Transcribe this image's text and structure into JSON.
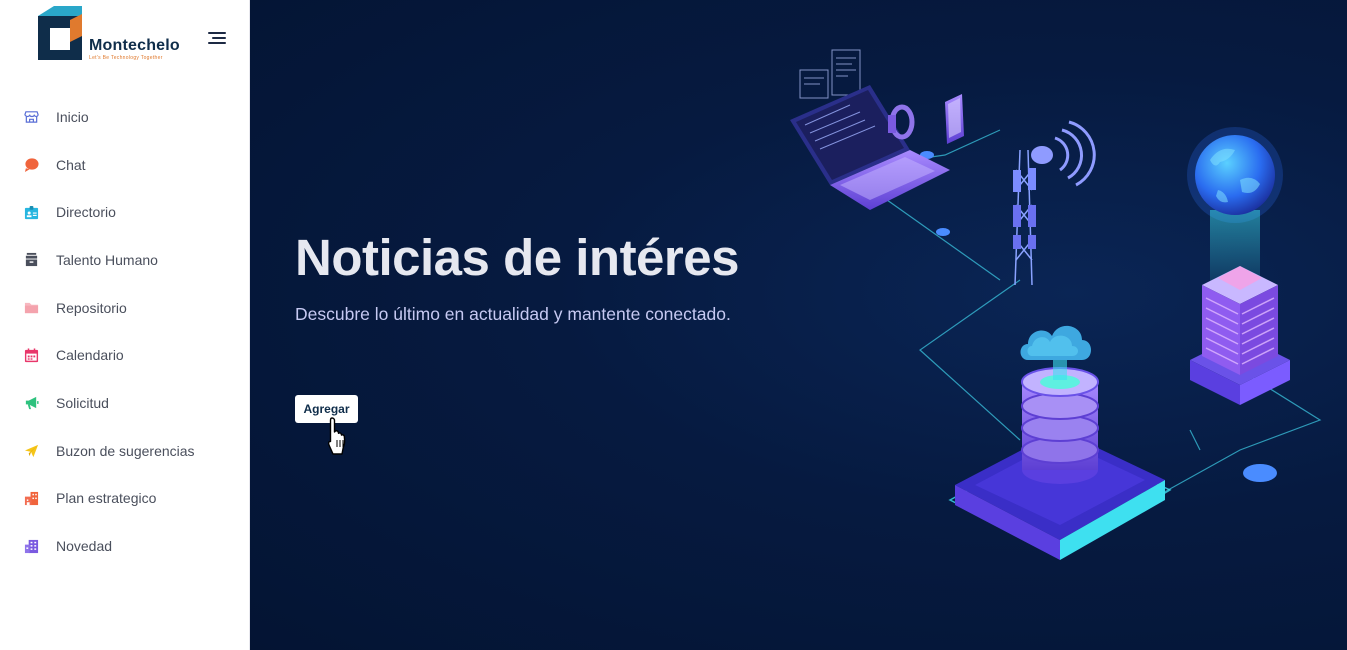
{
  "brand": {
    "name": "Montechelo",
    "tagline": "Let's Be Technology Together"
  },
  "sidebar": {
    "items": [
      {
        "label": "Inicio",
        "icon": "store-icon",
        "color": "#5a6fd6"
      },
      {
        "label": "Chat",
        "icon": "chat-bubble-icon",
        "color": "#f0643c"
      },
      {
        "label": "Directorio",
        "icon": "id-card-icon",
        "color": "#27b6e0"
      },
      {
        "label": "Talento Humano",
        "icon": "archive-box-icon",
        "color": "#4a4f5c"
      },
      {
        "label": "Repositorio",
        "icon": "folder-icon",
        "color": "#f4a3ad"
      },
      {
        "label": "Calendario",
        "icon": "calendar-icon",
        "color": "#e8366a"
      },
      {
        "label": "Solicitud",
        "icon": "megaphone-icon",
        "color": "#2ec27e"
      },
      {
        "label": "Buzon de sugerencias",
        "icon": "paper-plane-icon",
        "color": "#f5c518"
      },
      {
        "label": "Plan estrategico",
        "icon": "building-icon",
        "color": "#f0643c"
      },
      {
        "label": "Novedad",
        "icon": "office-building-icon",
        "color": "#7a5ae0"
      }
    ]
  },
  "hero": {
    "title": "Noticias de intéres",
    "subtitle": "Descubre lo último en actualidad y mantente conectado.",
    "button_label": "Agregar"
  },
  "colors": {
    "hero_bg": "#061a40",
    "accent_purple": "#7b5cff",
    "accent_cyan": "#3ee0f0"
  }
}
